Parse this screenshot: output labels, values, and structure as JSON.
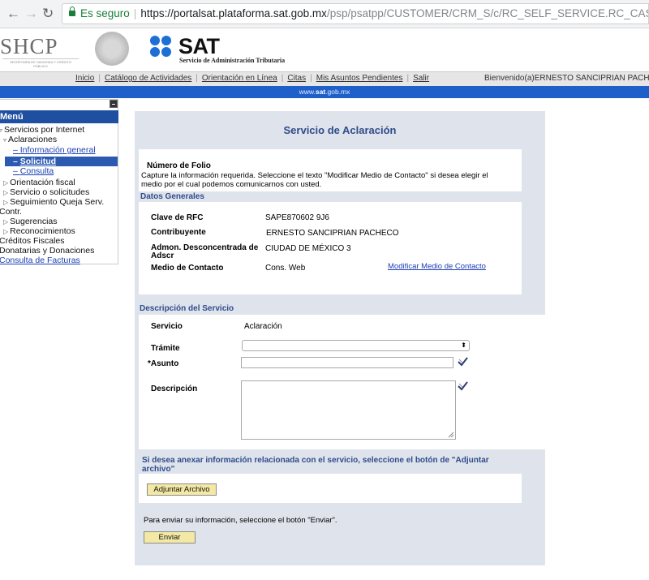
{
  "browser": {
    "secure_label": "Es seguro",
    "url_host": "https://portalsat.plataforma.sat.gob.mx",
    "url_path": "/psp/psatpp/CUSTOMER/CRM_S/c/RC_SELF_SERVICE.RC_CASE_SW_SS_RPT"
  },
  "header": {
    "shcp_logo": "SHCP",
    "shcp_sub": "SECRETARÍA DE HACIENDA Y CRÉDITO PÚBLICO",
    "sat_logo": "SAT",
    "sat_subtitle": "Servicio de Administración Tributaria",
    "sat_color": "#1d6fd6"
  },
  "topmenu": {
    "items": [
      "Inicio",
      "Catálogo de Actividades",
      "Orientación en Línea",
      "Citas",
      "Mis Asuntos Pendientes",
      "Salir"
    ],
    "welcome": "Bienvenido(a)ERNESTO SANCIPRIAN PACHECO"
  },
  "band": {
    "prefix": "www.",
    "bold": "sat",
    "suffix": ".gob.mx"
  },
  "sidebar": {
    "title": "Menú",
    "items": [
      "Servicios por Internet",
      "Aclaraciones",
      "Información general",
      "Solicitud",
      "Consulta",
      "Orientación fiscal",
      "Servicio o solicitudes",
      "Seguimiento Queja Serv.",
      "Contr.",
      "Sugerencias",
      "Reconocimientos",
      "Créditos Fiscales",
      "Donatarias y Donaciones",
      "Consulta de Facturas"
    ]
  },
  "form": {
    "title": "Servicio de Aclaración",
    "folio_label": "Número de Folio",
    "instructions_1": "Capture la información requerida. Seleccione el texto \"Modificar Medio de Contacto\" si desea elegir el",
    "instructions_2": "medio por el cual podemos comunicarnos con usted.",
    "datos_generales": "Datos Generales",
    "rfc_label": "Clave de RFC",
    "rfc_value": "SAPE870602 9J6",
    "contribuyente_label": "Contribuyente",
    "contribuyente_value": "ERNESTO SANCIPRIAN PACHECO",
    "admon_label_1": "Admon. Desconcentrada de",
    "admon_label_2": "Adscr",
    "admon_value": "CIUDAD DE MÉXICO 3",
    "medio_label": "Medio de Contacto",
    "medio_value": "Cons. Web",
    "modificar_link": "Modificar Medio de Contacto",
    "descripcion_servicio": "Descripción del Servicio",
    "servicio_label": "Servicio",
    "servicio_value": "Aclaración",
    "tramite_label": "Trámite",
    "tramite_value": "",
    "asunto_label": "*Asunto",
    "asunto_value": "",
    "descripcion_label": "Descripción",
    "descripcion_value": "",
    "anexar_1": "Si desea anexar información relacionada con el servicio, seleccione el botón de \"Adjuntar",
    "anexar_2": "archivo\"",
    "adjuntar_button": "Adjuntar Archivo",
    "enviar_text": "Para enviar su información, seleccione el botón \"Enviar\".",
    "enviar_button": "Enviar"
  }
}
